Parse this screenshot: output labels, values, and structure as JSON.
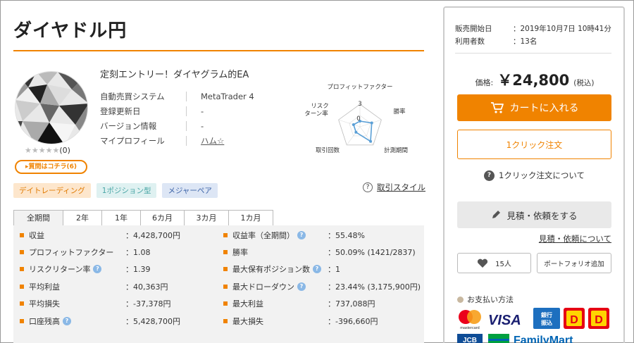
{
  "product": {
    "title": "ダイヤドル円",
    "subtitle": "定刻エントリー！ダイヤグラム的EA",
    "stars": "★★★★★",
    "review_count": "(0)",
    "question_button": "▸質問はコチラ(6)",
    "info": [
      {
        "key": "自動売買システム",
        "value": "MetaTrader 4"
      },
      {
        "key": "登録更新日",
        "value": "-"
      },
      {
        "key": "バージョン情報",
        "value": "-"
      },
      {
        "key": "マイプロフィール",
        "value": "ハム☆"
      }
    ],
    "tags": [
      "デイトレーディング",
      "1ポジション型",
      "メジャーペア"
    ],
    "style_link": "取引スタイル",
    "style_link_icon": "?"
  },
  "radar": {
    "labels": {
      "pf": "プロフィットファクター",
      "winrate": "勝率",
      "period": "計測期間",
      "trades": "取引回数",
      "risk_line1": "リスク",
      "risk_line2": "ターン率"
    },
    "scale_max": "3",
    "scale_mid": "0",
    "levels": {
      "pf": 0.25,
      "winrate": 0.55,
      "period": 0.8,
      "trades": 0.3,
      "risk": 0.3
    }
  },
  "tabs": [
    "全期間",
    "2年",
    "1年",
    "6カ月",
    "3カ月",
    "1カ月"
  ],
  "stats": {
    "left": [
      {
        "label": "収益",
        "hint": false,
        "value": "：4,428,700円"
      },
      {
        "label": "プロフィットファクター",
        "hint": false,
        "value": "：1.08"
      },
      {
        "label": "リスクリターン率",
        "hint": true,
        "value": "：1.39"
      },
      {
        "label": "平均利益",
        "hint": false,
        "value": "：40,363円"
      },
      {
        "label": "平均損失",
        "hint": false,
        "value": "：-37,378円"
      },
      {
        "label": "口座残高",
        "hint": true,
        "value": "：5,428,700円"
      }
    ],
    "right": [
      {
        "label": "収益率（全期間）",
        "hint": true,
        "value": "：55.48%"
      },
      {
        "label": "勝率",
        "hint": false,
        "value": "：50.09% (1421/2837)"
      },
      {
        "label": "最大保有ポジション数",
        "hint": true,
        "value": "：1"
      },
      {
        "label": "最大ドローダウン",
        "hint": true,
        "value": "：23.44% (3,175,900円)"
      },
      {
        "label": "最大利益",
        "hint": false,
        "value": "：737,088円"
      },
      {
        "label": "最大損失",
        "hint": false,
        "value": "：-396,660円"
      }
    ],
    "hint_glyph": "?"
  },
  "sidebar": {
    "meta": [
      {
        "key": "販売開始日",
        "value": "：2019年10月7日 10時41分"
      },
      {
        "key": "利用者数",
        "value": "：13名"
      }
    ],
    "price_label": "価格:",
    "price_value": "￥24,800",
    "price_tax": "(税込)",
    "cart_button": "カートに入れる",
    "oneclick_button": "1クリック注文",
    "oneclick_about": "1クリック注文について",
    "about_icon": "?",
    "quote_button": "見積・依頼をする",
    "quote_link": "見積・依頼について",
    "fav_count": "15人",
    "portfolio_button": "ポートフォリオ追加",
    "payment_heading": "お支払い方法",
    "payment_logos": {
      "mastercard_caption": "mastercard",
      "visa": "VISA",
      "bank_line1": "銀行",
      "bank_line2": "振込",
      "jcb": "JCB",
      "familymart": "FamilyMart"
    }
  },
  "colors": {
    "accent": "#f08300",
    "panel_border": "#cccccc",
    "stats_bg": "#f2f2f2",
    "radar_line": "#5a9fd6"
  }
}
